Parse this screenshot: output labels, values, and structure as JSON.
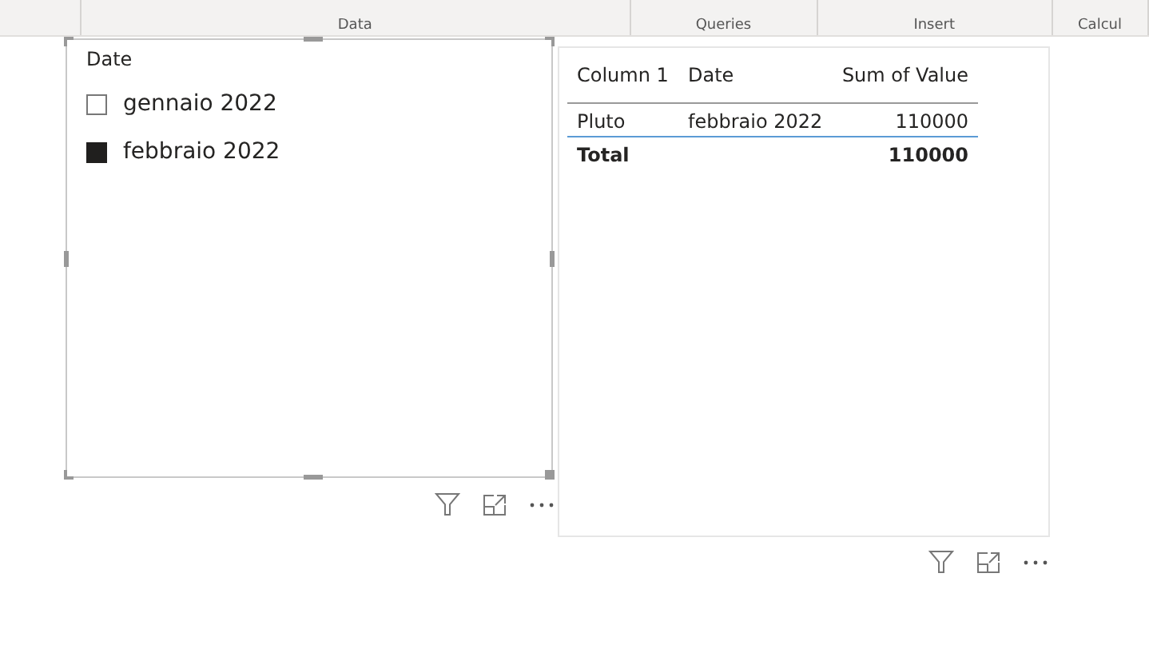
{
  "ribbon": {
    "groups": [
      {
        "label": "Data"
      },
      {
        "label": "Queries"
      },
      {
        "label": "Insert"
      },
      {
        "label": "Calcul"
      }
    ]
  },
  "slicer": {
    "title": "Date",
    "items": [
      {
        "label": "gennaio 2022",
        "selected": false
      },
      {
        "label": "febbraio 2022",
        "selected": true
      }
    ]
  },
  "table": {
    "columns": [
      "Column 1",
      "Date",
      "Sum of Value"
    ],
    "rows": [
      [
        "Pluto",
        "febbraio 2022",
        "110000"
      ]
    ],
    "total": {
      "label": "Total",
      "value": "110000"
    }
  }
}
